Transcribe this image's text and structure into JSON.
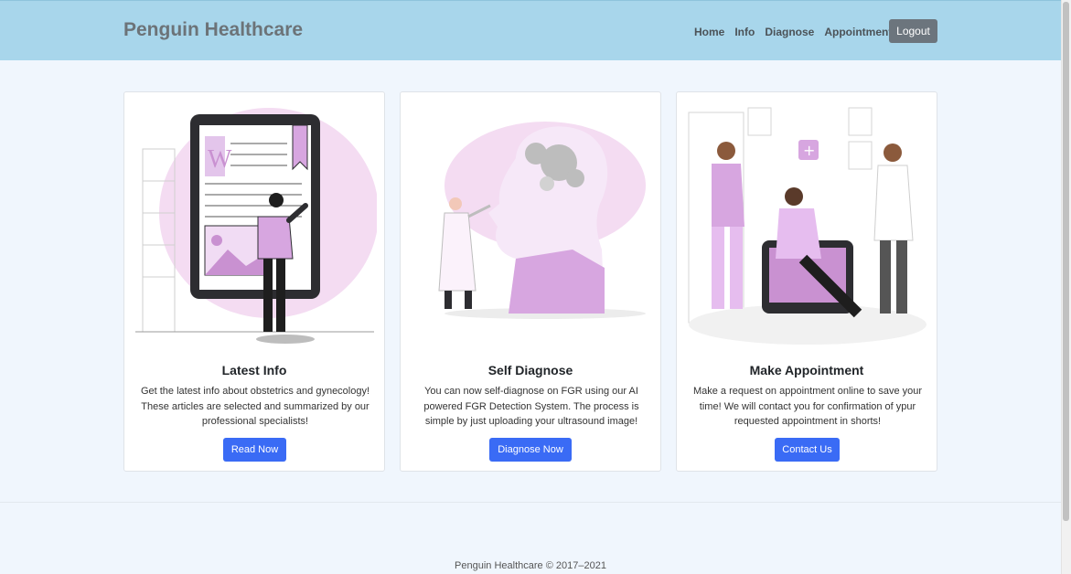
{
  "navbar": {
    "brand": "Penguin Healthcare",
    "links": [
      "Home",
      "Info",
      "Diagnose",
      "Appointment"
    ],
    "logout_label": "Logout",
    "background": "#a8d6eb"
  },
  "cards": [
    {
      "title": "Latest Info",
      "text": "Get the latest info about obstetrics and gynecology! These articles are selected and summarized by our professional specialists!",
      "button_label": "Read Now",
      "illustration_icon": "tablet-article-illustration"
    },
    {
      "title": "Self Diagnose",
      "text": "You can now self-diagnose on FGR using our AI powered FGR Detection System. The process is simple by just uploading your ultrasound image!",
      "button_label": "Diagnose Now",
      "illustration_icon": "brain-puzzle-illustration"
    },
    {
      "title": "Make Appointment",
      "text": "Make a request on appointment online to save your time! We will contact you for confirmation of ypur requested appointment in shorts!",
      "button_label": "Contact Us",
      "illustration_icon": "doctors-patient-illustration"
    }
  ],
  "footer": {
    "text": "Penguin Healthcare © 2017–2021"
  },
  "colors": {
    "accent": "#3a6bf5",
    "illustration": "#d7a6e0",
    "page_bg": "#f0f6fd"
  }
}
